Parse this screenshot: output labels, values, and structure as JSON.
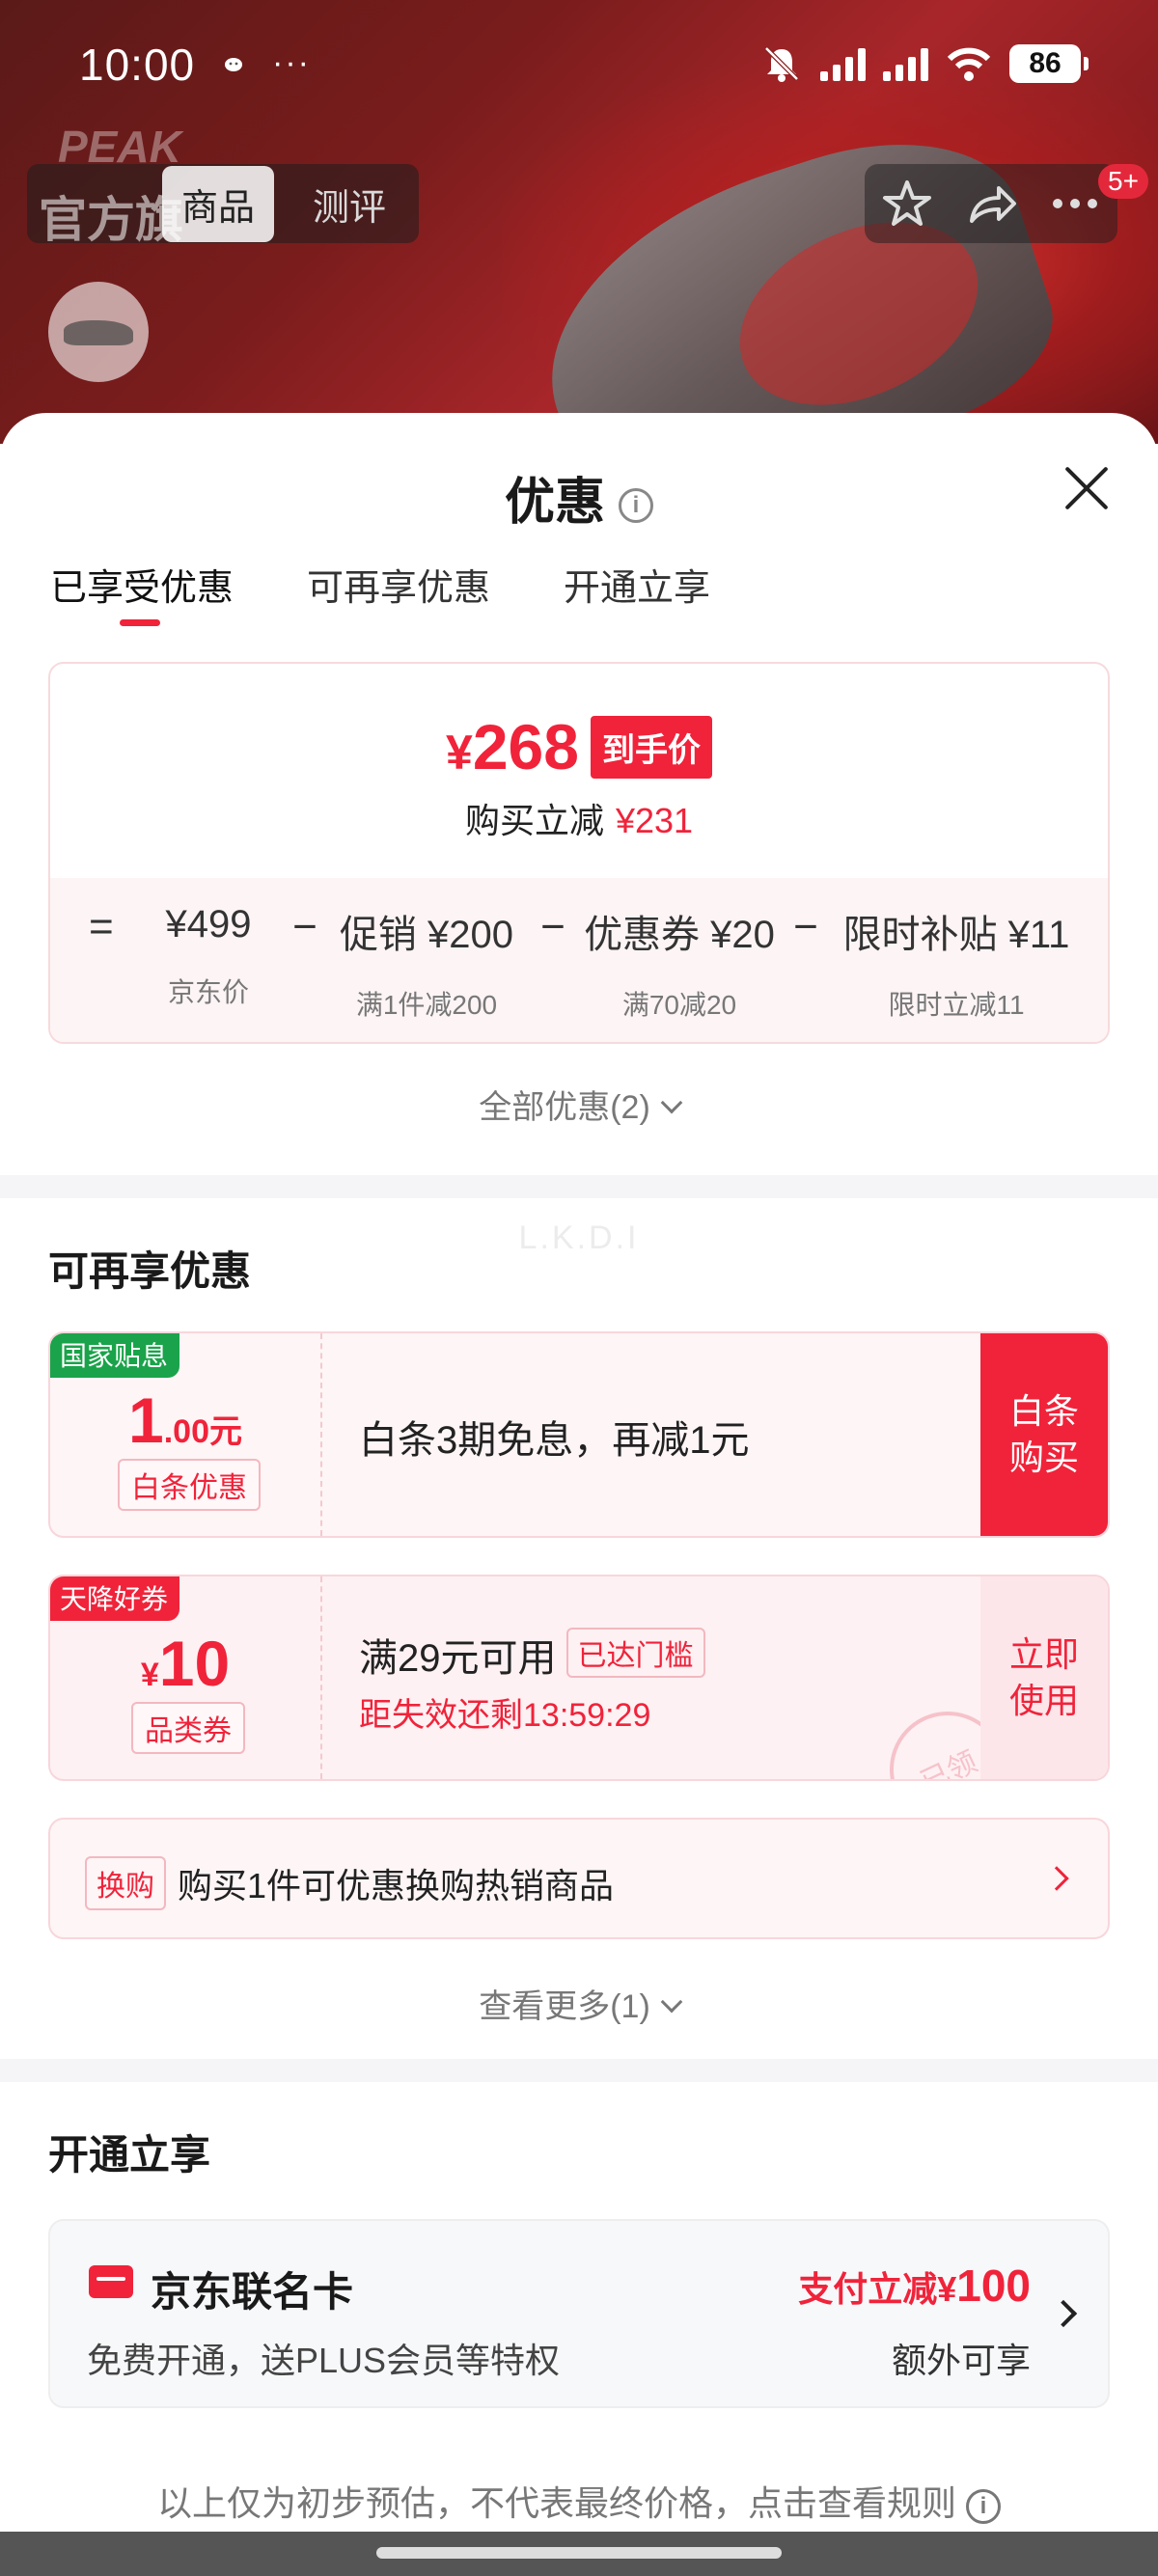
{
  "status_bar": {
    "time": "10:00",
    "dots": "···",
    "battery": "86"
  },
  "product_header": {
    "logo_text": "PEAK",
    "logo_sub": "官方旗",
    "tabs": [
      "商品",
      "测评"
    ],
    "badge": "5+"
  },
  "sheet": {
    "title": "优惠",
    "info_icon": "i",
    "tabs": [
      "已享受优惠",
      "可再享优惠",
      "开通立享"
    ],
    "summary": {
      "currency": "¥",
      "price": "268",
      "price_tag": "到手价",
      "reduce_label": "购买立减",
      "reduce_value": "¥231",
      "formula": [
        {
          "op": "=",
          "value": "¥499",
          "desc": "京东价"
        },
        {
          "op": "−",
          "value": "促销 ¥200",
          "desc": "满1件减200"
        },
        {
          "op": "−",
          "value": "优惠券 ¥20",
          "desc": "满70减20"
        },
        {
          "op": "−",
          "value": "限时补贴 ¥11",
          "desc": "限时立减11"
        }
      ]
    },
    "all_promos": "全部优惠(2)",
    "more_section": {
      "title": "可再享优惠",
      "ghost_text": "L.K.D.I",
      "coupons": [
        {
          "corner": "国家贴息",
          "amount_big": "1",
          "amount_small": ".00元",
          "tag": "白条优惠",
          "desc": "白条3期免息，再减1元",
          "button": "白条购买"
        },
        {
          "corner": "天降好券",
          "amount_prefix": "¥",
          "amount_big": "10",
          "tag": "品类券",
          "line1": "满29元可用",
          "reached": "已达门槛",
          "line2": "距失效还剩13:59:29",
          "button": "立即使用",
          "stamp": "已领"
        }
      ],
      "swap": {
        "tag": "换购",
        "text": "购买1件可优惠换购热销商品"
      },
      "see_more": "查看更多(1)"
    },
    "open_section": {
      "title": "开通立享",
      "card": {
        "name": "京东联名卡",
        "sub": "免费开通，送PLUS会员等特权",
        "pay_label": "支付立减¥",
        "pay_value": "100",
        "extra": "额外可享"
      }
    },
    "footer_note": "以上仅为初步预估，不代表最终价格，点击查看规则"
  },
  "colors": {
    "accent": "#f0233a",
    "national_badge": "#1aa34a"
  }
}
